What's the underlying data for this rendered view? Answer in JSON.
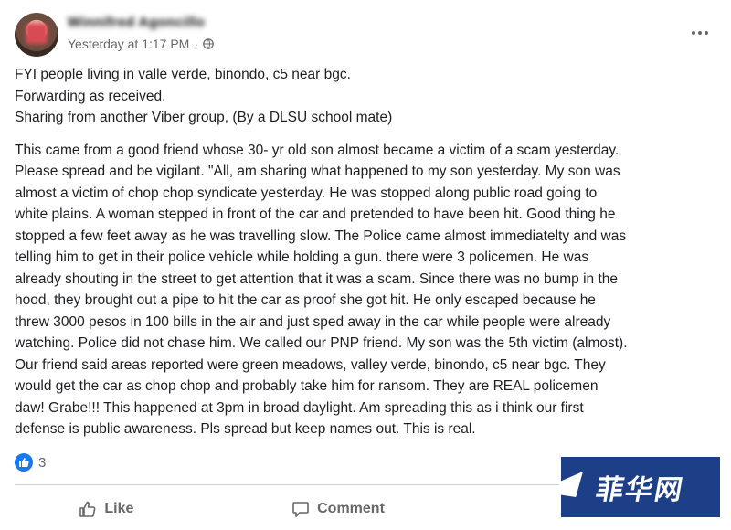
{
  "post": {
    "author": "Winnifred Agoncillo",
    "timestamp": "Yesterday at 1:17 PM",
    "separator": "·",
    "privacy_icon": "globe-icon",
    "more_icon": "more-horizontal-icon",
    "paragraph1": [
      "FYI people living in valle verde, binondo, c5 near bgc.",
      "Forwarding as received.",
      "Sharing from another Viber group, (By a DLSU school mate)"
    ],
    "paragraph2": [
      "This came from a good friend whose 30- yr old son almost became a victim of a scam yesterday.",
      "Please spread and be vigilant. \"All, am sharing what happened to my son yesterday. My son was",
      "almost a victim of chop chop syndicate yesterday. He was stopped along public road going to",
      "white plains. A woman stepped in front of the car and pretended to have been hit. Good thing he",
      "stopped a few feet away as he was travelling slow. The Police came almost immediatelty and was",
      "telling him to get in their police vehicle while holding a gun. there were 3 policemen. He was",
      "already shouting in the street to get attention that it was a scam. Since there was no bump in the",
      "hood, they brought out a pipe to hit the car as proof she got hit. He only escaped because he",
      "threw 3000 pesos in 100 bills in the air and just sped away in the car while people were already",
      "watching. Police did not chase him. We called our PNP friend. My son was the 5th victim (almost).",
      "Our friend said areas reported were green meadows, valley verde, binondo, c5 near bgc. They",
      "would get the car as chop chop and probably take  him for ransom. They are REAL policemen",
      "daw! Grabe!!! This happened at 3pm in broad daylight. Am spreading this as i think our first",
      "defense is public awareness. Pls spread but keep names out. This is real."
    ],
    "reaction_count": "3",
    "reaction_icon": "like-reaction-icon"
  },
  "actions": {
    "like_label": "Like",
    "comment_label": "Comment"
  },
  "watermark": {
    "text": "菲华网"
  },
  "colors": {
    "text": "#1c1e21",
    "secondary": "#65676b",
    "facebook_blue": "#1877f2",
    "watermark_bg": "#1c3f87"
  }
}
